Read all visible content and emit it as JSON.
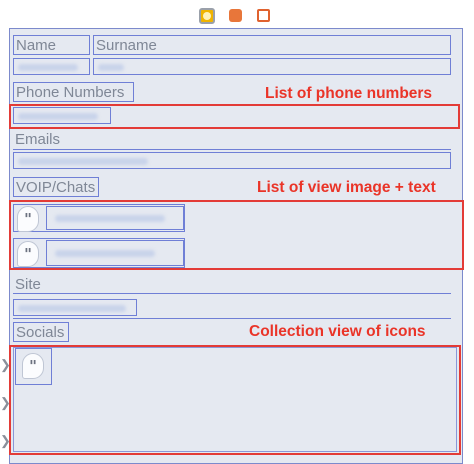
{
  "toolbar": {
    "icons": [
      "view-controller-icon",
      "first-responder-icon",
      "exit-icon"
    ]
  },
  "form": {
    "name_label": "Name",
    "surname_label": "Surname",
    "phone_label": "Phone Numbers",
    "emails_label": "Emails",
    "voip_label": "VOIP/Chats",
    "site_label": "Site",
    "socials_label": "Socials"
  },
  "annotations": {
    "phones": "List of phone numbers",
    "voip": "List of view image + text",
    "socials": "Collection view of icons"
  },
  "colors": {
    "annotation": "#e33b37",
    "constraint_box": "#6f7fd6",
    "scene_bg": "#e5e9f1"
  }
}
